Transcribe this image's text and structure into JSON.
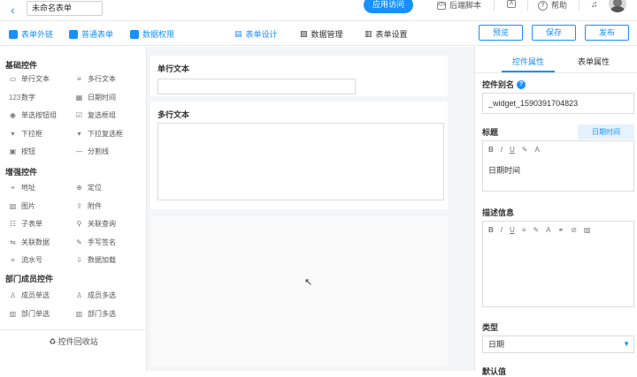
{
  "header": {
    "back_icon": "chevron-left",
    "form_name": "未命名表单",
    "visit_label": "应用访问",
    "backend_label": "后端脚本",
    "help_label": "帮助"
  },
  "toolbar": {
    "left_tabs": [
      "表单外链",
      "普通表单",
      "数据权限"
    ],
    "center_tabs": [
      "表单设计",
      "数据管理",
      "表单设置"
    ],
    "preview_label": "预览",
    "save_label": "保存",
    "publish_label": "发布"
  },
  "sidebar": {
    "basic_title": "基础控件",
    "basic_items": [
      {
        "label": "单行文本",
        "icon": "▭"
      },
      {
        "label": "多行文本",
        "icon": "≡"
      },
      {
        "label": "数字",
        "icon": "123"
      },
      {
        "label": "日期时间",
        "icon": "▦"
      },
      {
        "label": "单选按钮组",
        "icon": "◉"
      },
      {
        "label": "复选框组",
        "icon": "☑"
      },
      {
        "label": "下拉框",
        "icon": "▾"
      },
      {
        "label": "下拉复选框",
        "icon": "▾"
      },
      {
        "label": "按钮",
        "icon": "▣"
      },
      {
        "label": "分割线",
        "icon": "—"
      }
    ],
    "enhanced_title": "增强控件",
    "enhanced_items": [
      {
        "label": "地址",
        "icon": "⌖"
      },
      {
        "label": "定位",
        "icon": "⊕"
      },
      {
        "label": "图片",
        "icon": "▨"
      },
      {
        "label": "附件",
        "icon": "⇪"
      },
      {
        "label": "子表单",
        "icon": "☷"
      },
      {
        "label": "关联查询",
        "icon": "⚲"
      },
      {
        "label": "关联数据",
        "icon": "⇋"
      },
      {
        "label": "手写签名",
        "icon": "✎"
      },
      {
        "label": "流水号",
        "icon": "⌗"
      },
      {
        "label": "数据加载",
        "icon": "⇩"
      }
    ],
    "dept_title": "部门成员控件",
    "dept_items": [
      {
        "label": "成员单选",
        "icon": "♙"
      },
      {
        "label": "成员多选",
        "icon": "♙"
      },
      {
        "label": "部门单选",
        "icon": "▥"
      },
      {
        "label": "部门多选",
        "icon": "▥"
      }
    ],
    "recycle_label": "控件回收站"
  },
  "canvas": {
    "field1_label": "单行文本",
    "field2_label": "多行文本"
  },
  "props": {
    "tab_widget": "控件属性",
    "tab_form": "表单属性",
    "alias_label": "控件别名",
    "alias_value": "_widget_1590391704823",
    "title_label": "标题",
    "title_tag": "日期时间",
    "title_value": "日期时间",
    "desc_label": "描述信息",
    "type_label": "类型",
    "type_value": "日期",
    "default_label": "默认值"
  },
  "colors": {
    "accent": "#1890ff"
  }
}
